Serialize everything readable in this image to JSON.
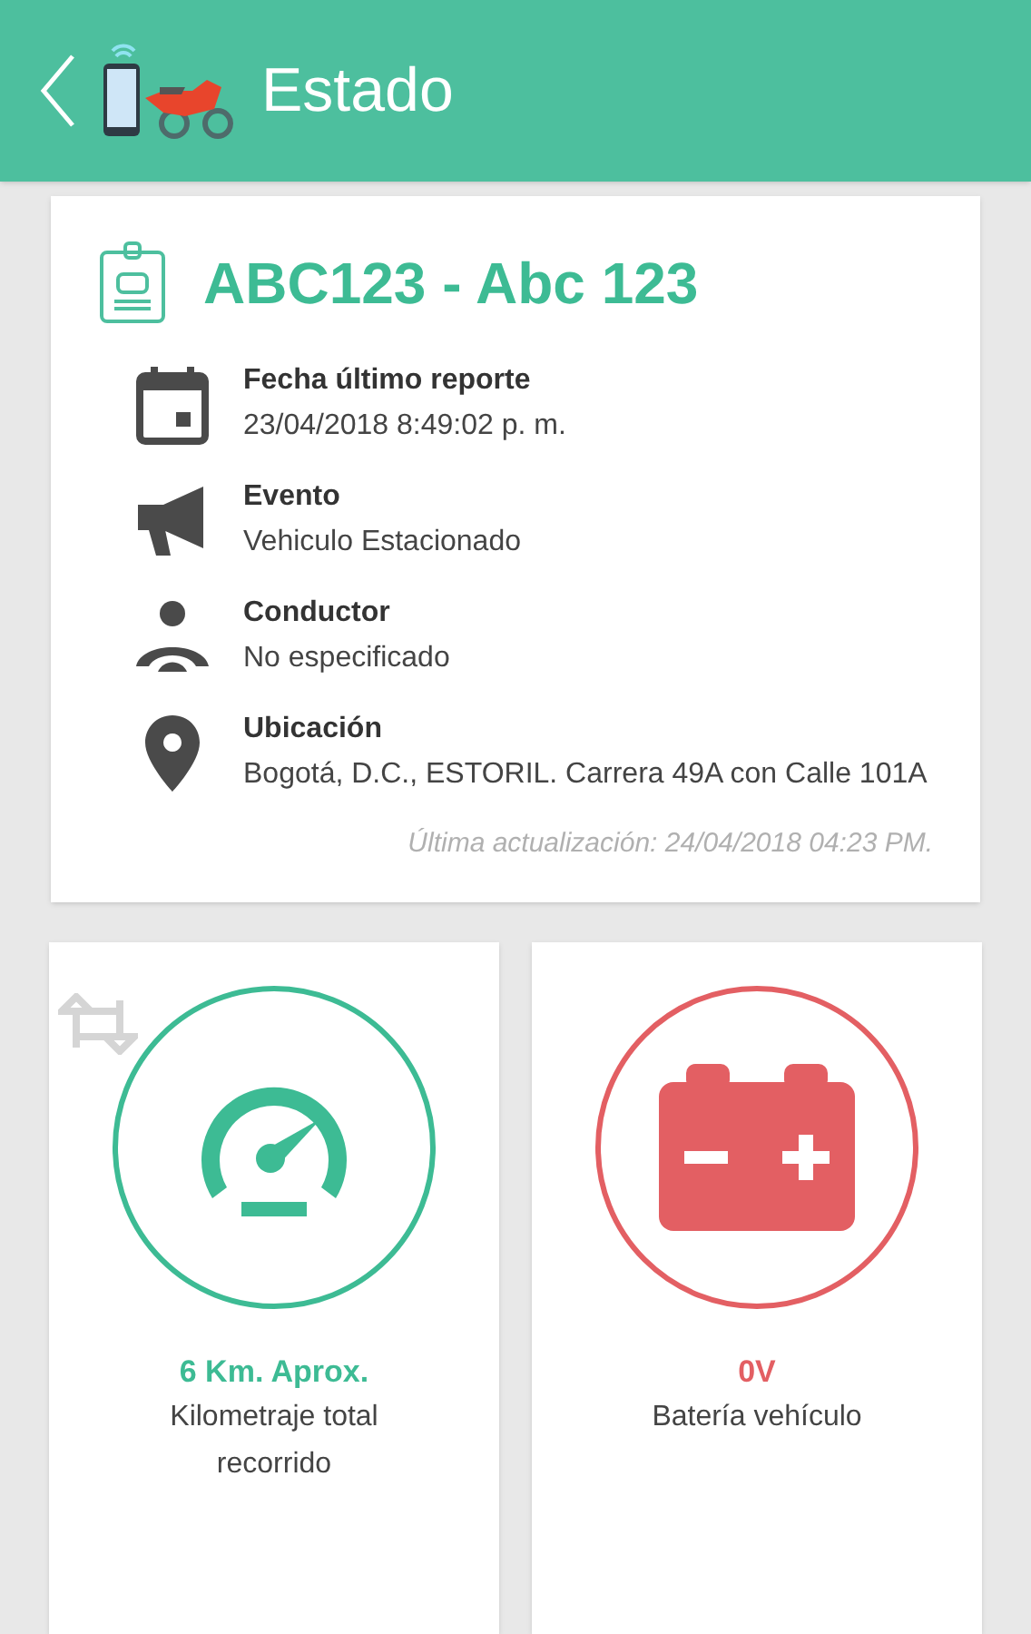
{
  "header": {
    "title": "Estado"
  },
  "vehicle": {
    "title": "ABC123 - Abc 123",
    "fields": [
      {
        "kind": "date",
        "label": "Fecha último reporte",
        "value": "23/04/2018 8:49:02 p. m."
      },
      {
        "kind": "event",
        "label": "Evento",
        "value": "Vehiculo Estacionado"
      },
      {
        "kind": "driver",
        "label": "Conductor",
        "value": "No especificado"
      },
      {
        "kind": "location",
        "label": "Ubicación",
        "value": "Bogotá, D.C., ESTORIL. Carrera 49A con Calle 101A"
      }
    ],
    "updated": "Última actualización: 24/04/2018 04:23 PM."
  },
  "tiles": [
    {
      "kind": "odometer",
      "color": "#3dbb94",
      "value": "6 Km. Aprox.",
      "label": "Kilometraje total recorrido"
    },
    {
      "kind": "battery",
      "color": "#e35f63",
      "value": "0V",
      "label": "Batería vehículo"
    }
  ]
}
